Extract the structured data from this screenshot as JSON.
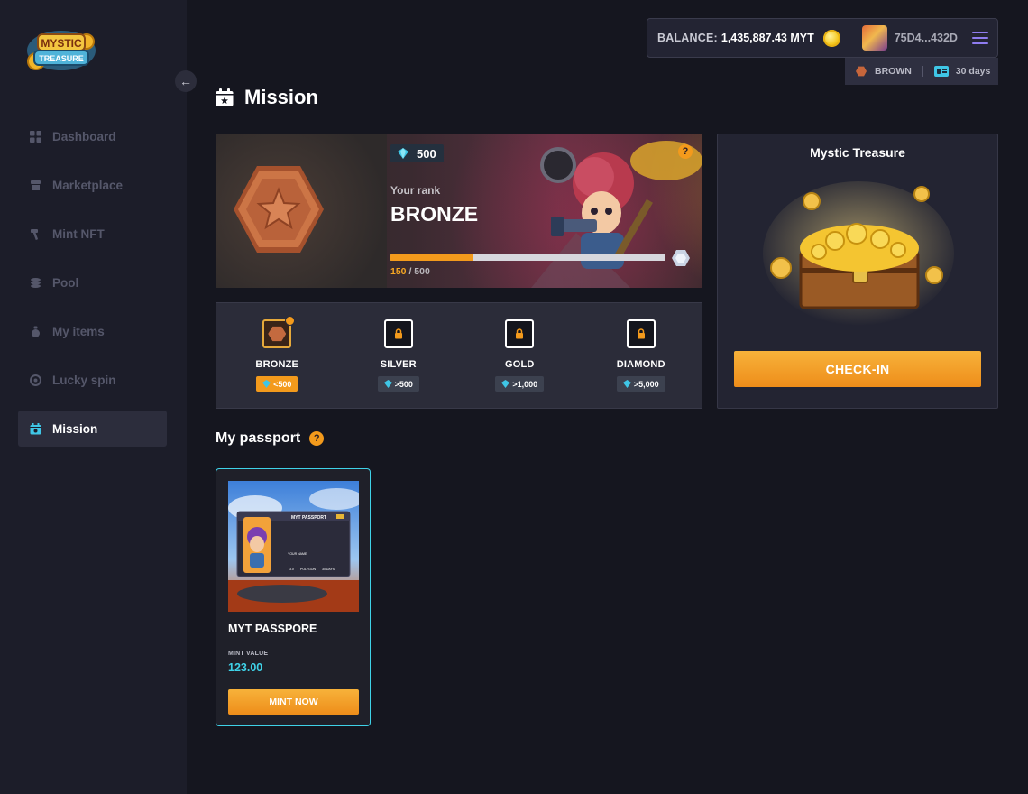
{
  "app": {
    "logo_text_1": "MYSTIC",
    "logo_text_2": "TREASURE"
  },
  "colors": {
    "accent": "#f39a1c",
    "cyan": "#3fd2e8",
    "background": "#15161f",
    "sidebar": "#1c1d29"
  },
  "sidebar": {
    "collapse_icon": "arrow-left-icon",
    "items": [
      {
        "label": "Dashboard",
        "icon": "grid-icon",
        "active": false
      },
      {
        "label": "Marketplace",
        "icon": "store-icon",
        "active": false
      },
      {
        "label": "Mint NFT",
        "icon": "hammer-icon",
        "active": false
      },
      {
        "label": "Pool",
        "icon": "coins-stack-icon",
        "active": false
      },
      {
        "label": "My items",
        "icon": "bag-icon",
        "active": false
      },
      {
        "label": "Lucky spin",
        "icon": "spin-icon",
        "active": false
      },
      {
        "label": "Mission",
        "icon": "calendar-icon",
        "active": true
      }
    ]
  },
  "header": {
    "balance_label": "BALANCE:",
    "balance_value": "1,435,887.43 MYT",
    "address": "75D4...432D",
    "rank_label": "BROWN",
    "days_label": "30 days"
  },
  "page": {
    "title": "Mission"
  },
  "rank_card": {
    "gems": "500",
    "your_rank_label": "Your rank",
    "rank_name": "BRONZE",
    "progress_current": "150",
    "progress_sep": " / ",
    "progress_max": "500",
    "progress_fraction": 0.3,
    "help": "?"
  },
  "tiers": [
    {
      "name": "BRONZE",
      "requirement": "<500",
      "unlocked": true
    },
    {
      "name": "SILVER",
      "requirement": ">500",
      "unlocked": false
    },
    {
      "name": "GOLD",
      "requirement": ">1,000",
      "unlocked": false
    },
    {
      "name": "DIAMOND",
      "requirement": ">5,000",
      "unlocked": false
    }
  ],
  "treasure": {
    "title": "Mystic Treasure",
    "button": "CHECK-IN"
  },
  "passport": {
    "section_title": "My passport",
    "help": "?",
    "card": {
      "name": "MYT PASSPORE",
      "mint_label": "MINT VALUE",
      "mint_value": "123.00",
      "button": "MINT NOW",
      "image_title": "MYT PASSPORT",
      "image_name": "YOUR NAME",
      "image_chain": "POLYGON",
      "image_days": "30 DAYS",
      "image_version": "3.0"
    }
  }
}
